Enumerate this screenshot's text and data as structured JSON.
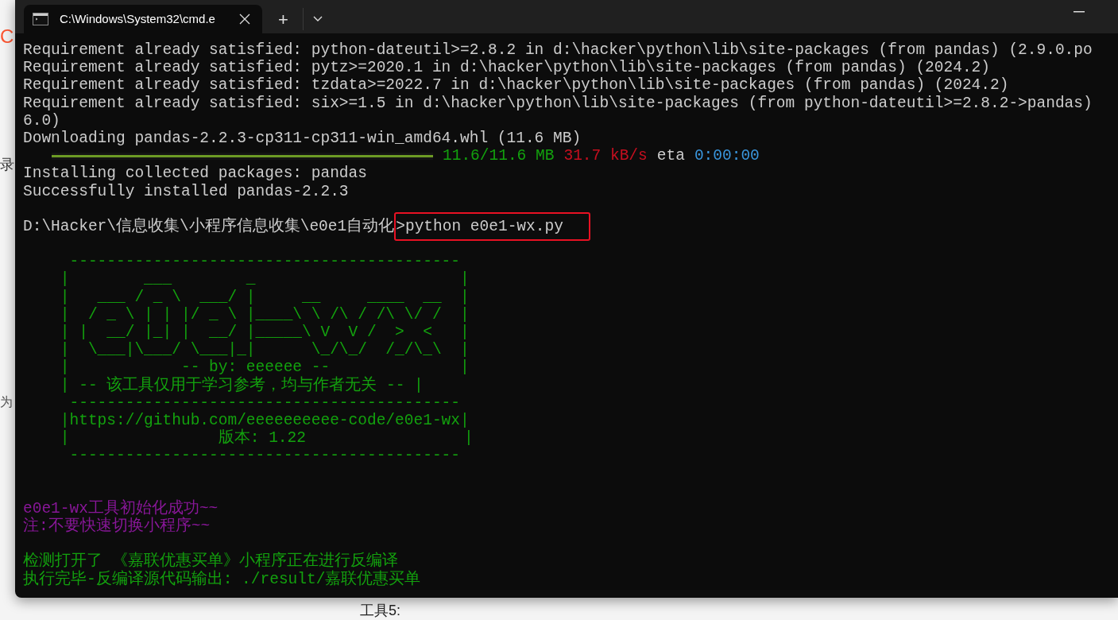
{
  "background": {
    "logo_fragment": "C",
    "side_texts": [
      "录",
      "为"
    ],
    "below_text": "工具5:"
  },
  "window": {
    "tab_title": "C:\\Windows\\System32\\cmd.e",
    "new_tab": "+"
  },
  "terminal": {
    "lines": [
      {
        "kind": "text",
        "segments": [
          {
            "text": "Requirement already satisfied: python-dateutil>=2.8.2 in d:\\hacker\\python\\lib\\site-packages (from pandas) (2.9.0.po",
            "color": "#cccccc"
          }
        ]
      },
      {
        "kind": "text",
        "segments": [
          {
            "text": "Requirement already satisfied: pytz>=2020.1 in d:\\hacker\\python\\lib\\site-packages (from pandas) (2024.2)",
            "color": "#cccccc"
          }
        ]
      },
      {
        "kind": "text",
        "segments": [
          {
            "text": "Requirement already satisfied: tzdata>=2022.7 in d:\\hacker\\python\\lib\\site-packages (from pandas) (2024.2)",
            "color": "#cccccc"
          }
        ]
      },
      {
        "kind": "text",
        "segments": [
          {
            "text": "Requirement already satisfied: six>=1.5 in d:\\hacker\\python\\lib\\site-packages (from python-dateutil>=2.8.2->pandas)",
            "color": "#cccccc"
          }
        ]
      },
      {
        "kind": "text",
        "segments": [
          {
            "text": "6.0)",
            "color": "#cccccc"
          }
        ]
      },
      {
        "kind": "text",
        "segments": [
          {
            "text": "Downloading pandas-2.2.3-cp311-cp311-win_amd64.whl (11.6 MB)",
            "color": "#cccccc"
          }
        ]
      },
      {
        "kind": "progress",
        "level": 1,
        "segments": [
          {
            "text": "11.6/11.6 MB",
            "color": "#13a10e"
          },
          {
            "text": "31.7 kB/s",
            "color": "#c50f1f"
          },
          {
            "text": "eta",
            "color": "#cccccc"
          },
          {
            "text": "0:00:00",
            "color": "#3a96dd"
          }
        ]
      },
      {
        "kind": "text",
        "segments": [
          {
            "text": "Installing collected packages: pandas",
            "color": "#cccccc"
          }
        ]
      },
      {
        "kind": "text",
        "segments": [
          {
            "text": "Successfully installed pandas-2.2.3",
            "color": "#cccccc"
          }
        ]
      },
      {
        "kind": "blank"
      },
      {
        "kind": "text",
        "segments": [
          {
            "text": "D:\\Hacker\\信息收集\\小程序信息收集\\e0e1自动化",
            "color": "#cccccc"
          },
          {
            "text": ">python e0e1-wx.py",
            "color": "#cccccc",
            "highlighted": true
          }
        ]
      },
      {
        "kind": "blank"
      },
      {
        "kind": "text",
        "segments": [
          {
            "text": "     ------------------------------------------",
            "color": "#13a10e"
          }
        ]
      },
      {
        "kind": "text",
        "segments": [
          {
            "text": "    |        ___        _                      |",
            "color": "#13a10e"
          }
        ]
      },
      {
        "kind": "text",
        "segments": [
          {
            "text": "    |   ___ / _ \\  ___/ |     __     ____  __  |",
            "color": "#13a10e"
          }
        ]
      },
      {
        "kind": "text",
        "segments": [
          {
            "text": "    |  / _ \\ | | |/ _ \\ |____\\ \\ /\\ / /\\ \\/ /  |",
            "color": "#13a10e"
          }
        ]
      },
      {
        "kind": "text",
        "segments": [
          {
            "text": "    | |  __/ |_| |  __/ |_____\\ V  V /  >  <   |",
            "color": "#13a10e"
          }
        ]
      },
      {
        "kind": "text",
        "segments": [
          {
            "text": "    |  \\___|\\___/ \\___|_|      \\_/\\_/  /_/\\_\\  |",
            "color": "#13a10e"
          }
        ]
      },
      {
        "kind": "text",
        "segments": [
          {
            "text": "    |            -- by: eeeeee --              |",
            "color": "#13a10e"
          }
        ]
      },
      {
        "kind": "text",
        "segments": [
          {
            "text": "    | -- 该工具仅用于学习参考，均与作者无关 -- |",
            "color": "#13a10e"
          }
        ]
      },
      {
        "kind": "text",
        "segments": [
          {
            "text": "     ------------------------------------------",
            "color": "#13a10e"
          }
        ]
      },
      {
        "kind": "text",
        "segments": [
          {
            "text": "    |https://github.com/eeeeeeeeee-code/e0e1-wx|",
            "color": "#13a10e"
          }
        ]
      },
      {
        "kind": "text",
        "segments": [
          {
            "text": "    |                版本: 1.22                 |",
            "color": "#13a10e"
          }
        ]
      },
      {
        "kind": "text",
        "segments": [
          {
            "text": "     ------------------------------------------",
            "color": "#13a10e"
          }
        ]
      },
      {
        "kind": "blank"
      },
      {
        "kind": "blank"
      },
      {
        "kind": "text",
        "segments": [
          {
            "text": "e0e1-wx工具初始化成功~~",
            "color": "#881798"
          }
        ]
      },
      {
        "kind": "text",
        "segments": [
          {
            "text": "注:不要快速切换小程序~~",
            "color": "#881798"
          }
        ]
      },
      {
        "kind": "blank"
      },
      {
        "kind": "text",
        "segments": [
          {
            "text": "检测打开了 《嘉联优惠买单》小程序正在进行反编译",
            "color": "#13a10e"
          }
        ]
      },
      {
        "kind": "text",
        "segments": [
          {
            "text": "执行完毕-反编译源代码输出: ./result/嘉联优惠买单",
            "color": "#13a10e"
          }
        ]
      }
    ]
  }
}
